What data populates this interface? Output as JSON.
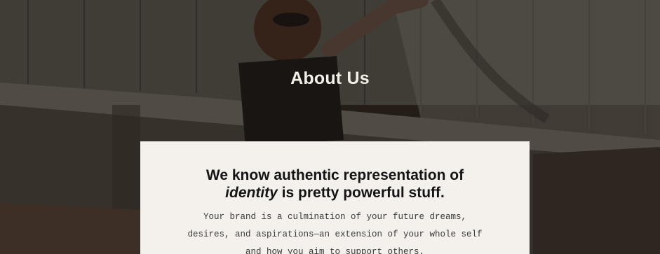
{
  "hero": {
    "title": "About Us"
  },
  "card": {
    "heading_line1": "We know authentic representation of",
    "heading_em": "identity",
    "heading_rest": " is pretty powerful stuff.",
    "body_line1": "Your brand is a culmination of your future dreams,",
    "body_line2": "desires, and aspirations—an extension of your whole self",
    "body_line3": "and how you aim to support others."
  },
  "colors": {
    "overlay": "#1d1712",
    "card_bg": "#f4f1ec",
    "title": "#f3eee6",
    "heading": "#141414"
  }
}
